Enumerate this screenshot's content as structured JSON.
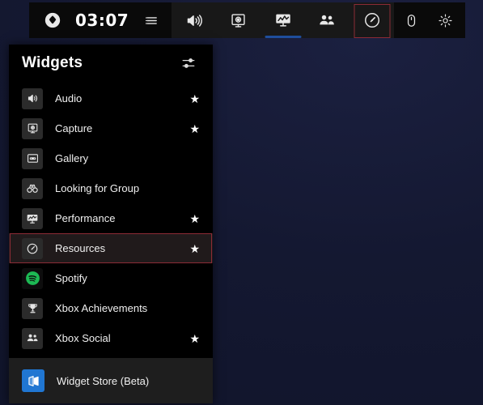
{
  "gamebar": {
    "xbox_logo": "xbox-logo-icon",
    "clock": "03:07",
    "menu_icon": "list-menu-icon",
    "tabs": [
      {
        "name": "audio",
        "icon": "speaker-icon",
        "active": false,
        "boxed": false
      },
      {
        "name": "capture",
        "icon": "capture-camera-icon",
        "active": false,
        "boxed": false
      },
      {
        "name": "performance",
        "icon": "performance-monitor-icon",
        "active": true,
        "boxed": false
      },
      {
        "name": "social",
        "icon": "people-icon",
        "active": false,
        "boxed": false
      },
      {
        "name": "resources",
        "icon": "gauge-icon",
        "active": false,
        "boxed": true
      }
    ],
    "right_icons": [
      {
        "name": "mouse",
        "icon": "mouse-icon"
      },
      {
        "name": "settings",
        "icon": "gear-icon"
      }
    ]
  },
  "panel": {
    "title": "Widgets",
    "filter_icon": "sliders-filter-icon",
    "items": [
      {
        "label": "Audio",
        "icon": "speaker-icon",
        "starred": true,
        "highlighted": false
      },
      {
        "label": "Capture",
        "icon": "capture-camera-icon",
        "starred": true,
        "highlighted": false
      },
      {
        "label": "Gallery",
        "icon": "gallery-image-icon",
        "starred": false,
        "highlighted": false
      },
      {
        "label": "Looking for Group",
        "icon": "binoculars-icon",
        "starred": false,
        "highlighted": false
      },
      {
        "label": "Performance",
        "icon": "performance-monitor-icon",
        "starred": true,
        "highlighted": false
      },
      {
        "label": "Resources",
        "icon": "gauge-icon",
        "starred": true,
        "highlighted": true
      },
      {
        "label": "Spotify",
        "icon": "spotify-icon",
        "starred": false,
        "highlighted": false
      },
      {
        "label": "Xbox Achievements",
        "icon": "trophy-icon",
        "starred": false,
        "highlighted": false
      },
      {
        "label": "Xbox Social",
        "icon": "people-icon",
        "starred": true,
        "highlighted": false
      }
    ],
    "footer": {
      "label": "Widget Store (Beta)",
      "icon": "microsoft-store-icon"
    }
  },
  "colors": {
    "accent_blue": "#1f4e9c",
    "highlight_red": "#8c2b36",
    "panel_black": "#000000",
    "footer_gray": "#1e1e1e",
    "desktop_navy": "#141831",
    "spotify_green": "#1db954",
    "store_blue": "#2076d2"
  },
  "star_glyph": "★"
}
